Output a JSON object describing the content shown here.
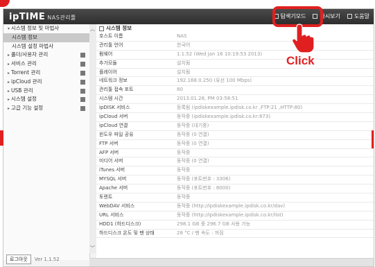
{
  "header": {
    "logo": "ipTIME",
    "logo_sub": "NAS관리툴",
    "menu": [
      {
        "label": "탐색기모드",
        "icon": "window-icon"
      },
      {
        "label": "다시보기",
        "icon": "refresh-icon"
      },
      {
        "label": "도움말",
        "icon": "help-icon"
      }
    ]
  },
  "sidebar": {
    "items": [
      {
        "label": "시스템 정보 및 마법사",
        "caret": "▾"
      },
      {
        "label": "시스템 정보"
      },
      {
        "label": "시스템 설정 마법사"
      },
      {
        "label": "폴더/사용자 관리",
        "caret": "▸"
      },
      {
        "label": "서비스 관리",
        "caret": "▸"
      },
      {
        "label": "Torrent 관리",
        "caret": "▸"
      },
      {
        "label": "ipCloud 관리",
        "caret": "▸"
      },
      {
        "label": "USB 관리",
        "caret": "▸"
      },
      {
        "label": "시스템 설정",
        "caret": "▸"
      },
      {
        "label": "고급 기능 설정",
        "caret": "▸"
      }
    ],
    "logout_label": "로그아웃",
    "version": "Ver 1.1.52"
  },
  "content": {
    "section_title": "시스템 정보",
    "rows": [
      {
        "key": "호스트 이름",
        "value": "NAS"
      },
      {
        "key": "관리툴 언어",
        "value": "한국어"
      },
      {
        "key": "펌웨어",
        "value": "1.1.52 (Wed Jan 16 10:19:53 2013)"
      },
      {
        "key": "추가모듈",
        "value": "설치됨"
      },
      {
        "key": "플레이어",
        "value": "설치됨"
      },
      {
        "key": "네트워크 정보",
        "value": "192.168.0.250 (유선 100 Mbps)"
      },
      {
        "key": "관리툴 접속 포트",
        "value": "80"
      },
      {
        "key": "시스템 시간",
        "value": "2013.01.28, PM 03:58:51"
      },
      {
        "key": "ipDISK 서비스",
        "value": "등록됨 (ipdiskexample.ipdisk.co.kr ,FTP:21 ,HTTP:80)"
      },
      {
        "key": "ipCloud 서버",
        "value": "동작중 (ipdiskexample.ipdisk.co.kr:873)"
      },
      {
        "key": "ipCloud 연결",
        "value": "동작중 (대기중)"
      },
      {
        "key": "윈도우 파일 공유",
        "value": "동작중 (0 연결)"
      },
      {
        "key": "FTP 서버",
        "value": "동작중 (0 연결)"
      },
      {
        "key": "AFP 서버",
        "value": "동작중"
      },
      {
        "key": "미디어 서버",
        "value": "동작중 (0 연결)"
      },
      {
        "key": "iTunes 서버",
        "value": "동작중"
      },
      {
        "key": "MYSQL 서버",
        "value": "동작중 (포트번호 : 3306)"
      },
      {
        "key": "Apache 서버",
        "value": "동작중 (포트번호 : 8000)"
      },
      {
        "key": "토렌트",
        "value": "동작중"
      },
      {
        "key": "WebDAV 서비스",
        "value": "동작중 (http://ipdiskexample.ipdisk.co.kr/dav)"
      },
      {
        "key": "URL 서비스",
        "value": "동작중 (http://ipdiskexample.ipdisk.co.kr/list)"
      },
      {
        "key": "HDD1 (하드디스크)",
        "value": "298.1 GB 중 296.7 GB 사용 가능"
      },
      {
        "key": "하드디스크 온도 및 팬 상태",
        "value": "28 °C / 팬 속도 : 꺼짐"
      }
    ]
  },
  "annotation": {
    "click_label": "Click",
    "accent_color": "#e02020"
  }
}
